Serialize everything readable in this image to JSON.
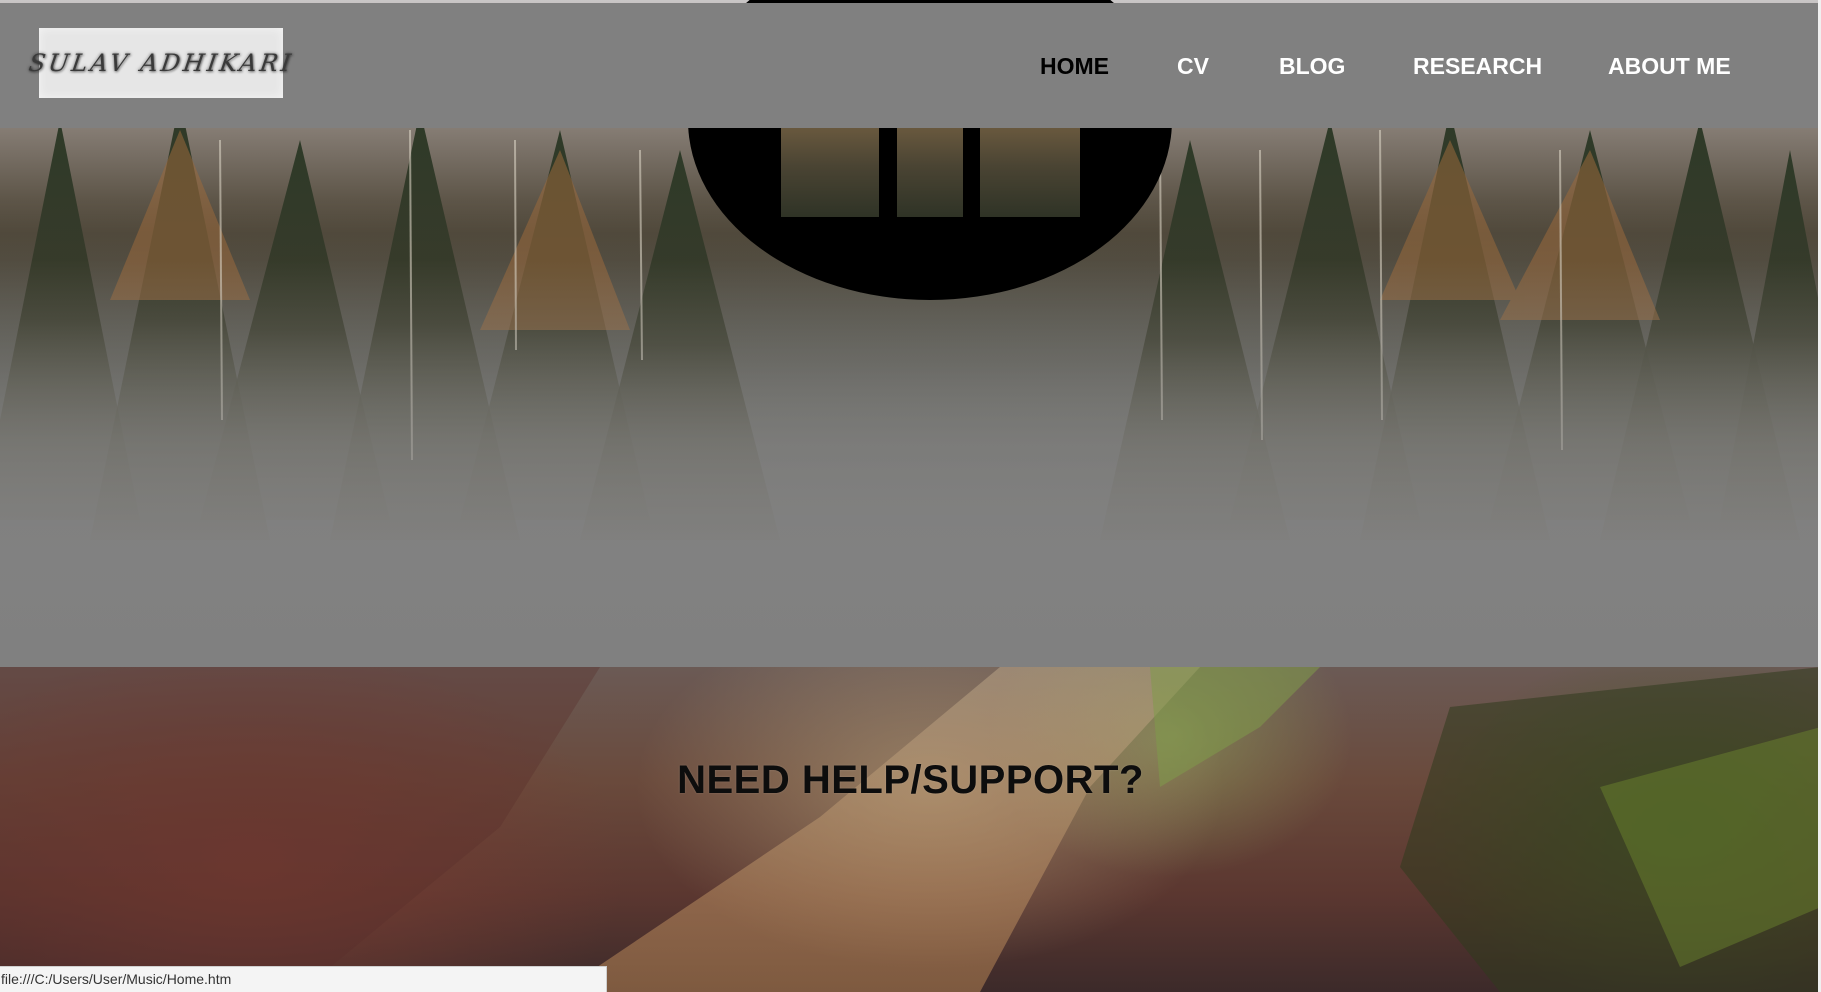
{
  "logo": {
    "text": "SULAV ADHIKARI"
  },
  "nav": {
    "items": [
      {
        "label": "HOME",
        "active": true
      },
      {
        "label": "CV",
        "active": false
      },
      {
        "label": "BLOG",
        "active": false
      },
      {
        "label": "RESEARCH",
        "active": false
      },
      {
        "label": "ABOUT ME",
        "active": false
      }
    ]
  },
  "support": {
    "title": "NEED HELP/SUPPORT?"
  },
  "statusbar": {
    "url": "file:///C:/Users/User/Music/Home.htm"
  },
  "colors": {
    "navbar_bg": "#808080",
    "nav_text": "#ffffff",
    "nav_active_text": "#000000",
    "logo_bg": "#e6e6e6",
    "emblem": "#000000"
  }
}
